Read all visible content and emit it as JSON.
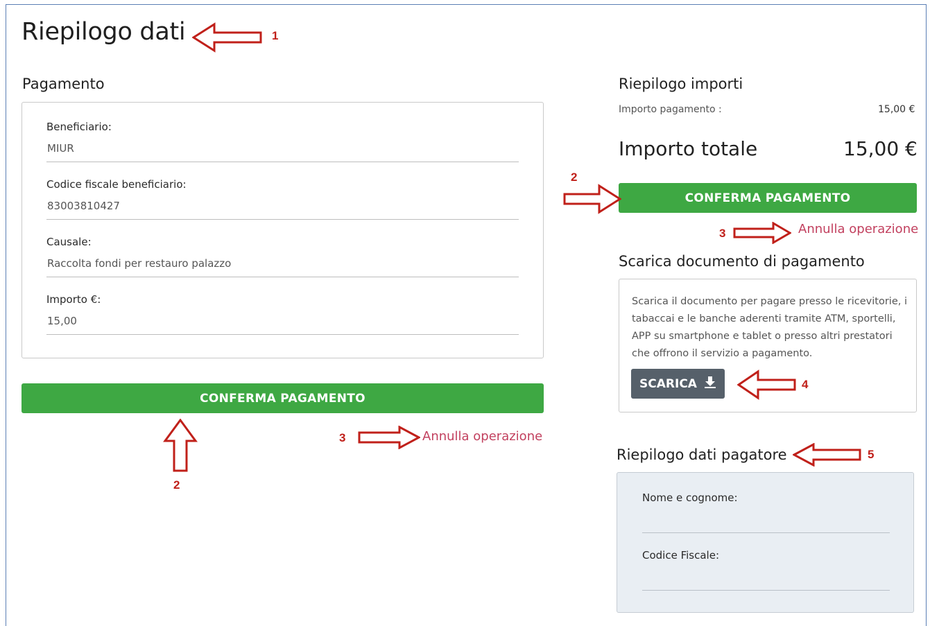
{
  "page": {
    "title": "Riepilogo dati"
  },
  "payment": {
    "section_title": "Pagamento",
    "fields": [
      {
        "label": "Beneficiario:",
        "value": "MIUR"
      },
      {
        "label": "Codice fiscale beneficiario:",
        "value": "83003810427"
      },
      {
        "label": "Causale:",
        "value": "Raccolta fondi per restauro palazzo"
      },
      {
        "label": "Importo €:",
        "value": "15,00"
      }
    ],
    "confirm_label": "CONFERMA PAGAMENTO",
    "cancel_label": "Annulla operazione"
  },
  "summary": {
    "section_title": "Riepilogo importi",
    "payment_amount_label": "Importo pagamento :",
    "payment_amount_value": "15,00 €",
    "total_label": "Importo totale",
    "total_value": "15,00 €",
    "confirm_label": "CONFERMA PAGAMENTO",
    "cancel_label": "Annulla operazione"
  },
  "download": {
    "section_title": "Scarica documento di pagamento",
    "description": "Scarica il documento per pagare presso le ricevitorie, i tabaccai e le banche aderenti tramite ATM, sportelli, APP su smartphone e tablet o presso altri prestatori che offrono il servizio a pagamento.",
    "button_label": "SCARICA",
    "button_icon": "download-icon"
  },
  "payer": {
    "section_title": "Riepilogo dati pagatore",
    "name_label": "Nome e cognome:",
    "name_value": "",
    "tax_code_label": "Codice Fiscale:",
    "tax_code_value": ""
  },
  "annotations": {
    "n1": "1",
    "n2": "2",
    "n3": "3",
    "n4": "4",
    "n5": "5",
    "color": "#c0201a"
  },
  "colors": {
    "confirm_button": "#3ea843",
    "download_button": "#56606a",
    "cancel_link": "#c2415f",
    "payer_card_bg": "#e9eef3"
  }
}
